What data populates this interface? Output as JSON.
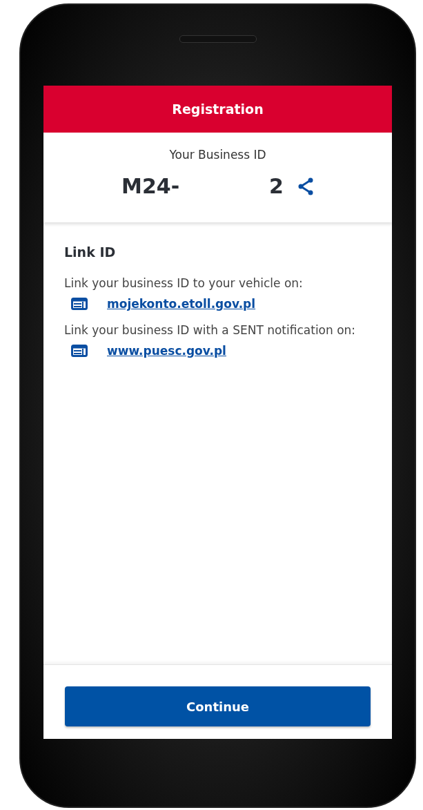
{
  "header": {
    "title": "Registration"
  },
  "business_id": {
    "label": "Your Business ID",
    "start": "M24-",
    "end": "2"
  },
  "link_section": {
    "title": "Link ID",
    "items": [
      {
        "text": "Link your business ID to your vehicle on:",
        "link": "mojekonto.etoll.gov.pl"
      },
      {
        "text": "Link your business ID with a SENT notification on:",
        "link": "www.puesc.gov.pl"
      }
    ]
  },
  "footer": {
    "button": "Continue"
  }
}
